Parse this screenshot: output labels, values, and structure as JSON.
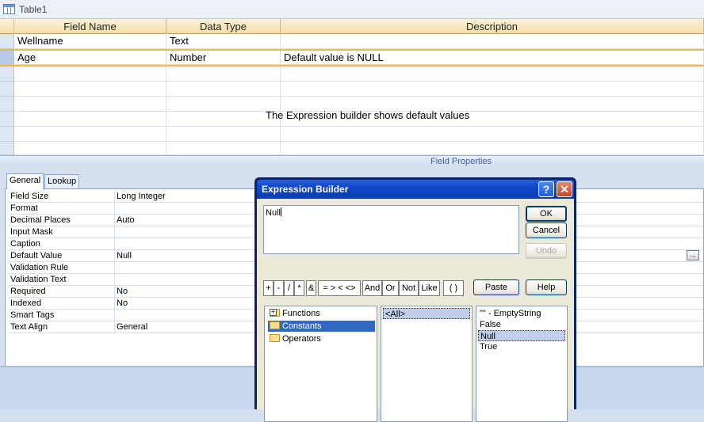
{
  "window": {
    "title": "Table1"
  },
  "grid": {
    "headers": [
      "Field Name",
      "Data Type",
      "Description"
    ],
    "rows": [
      {
        "field_name": "Wellname",
        "data_type": "Text",
        "description": ""
      },
      {
        "field_name": "Age",
        "data_type": "Number",
        "description": "Default value is NULL"
      }
    ],
    "annotation": "The Expression builder shows default values"
  },
  "field_properties": {
    "title": "Field Properties",
    "tabs": [
      "General",
      "Lookup"
    ],
    "rows": [
      {
        "label": "Field Size",
        "value": "Long Integer"
      },
      {
        "label": "Format",
        "value": ""
      },
      {
        "label": "Decimal Places",
        "value": "Auto"
      },
      {
        "label": "Input Mask",
        "value": ""
      },
      {
        "label": "Caption",
        "value": ""
      },
      {
        "label": "Default Value",
        "value": "Null"
      },
      {
        "label": "Validation Rule",
        "value": ""
      },
      {
        "label": "Validation Text",
        "value": ""
      },
      {
        "label": "Required",
        "value": "No"
      },
      {
        "label": "Indexed",
        "value": "No"
      },
      {
        "label": "Smart Tags",
        "value": ""
      },
      {
        "label": "Text Align",
        "value": "General"
      }
    ],
    "build_button": "..."
  },
  "dialog": {
    "title": "Expression Builder",
    "help_glyph": "?",
    "close_glyph": "✕",
    "expression": "Null",
    "buttons": {
      "ok": "OK",
      "cancel": "Cancel",
      "undo": "Undo",
      "paste": "Paste",
      "help": "Help"
    },
    "operators": [
      "+",
      "-",
      "/",
      "*",
      "&",
      "= > < <>",
      "And",
      "Or",
      "Not",
      "Like",
      "( )"
    ],
    "folders": [
      {
        "label": "Functions",
        "expandable": true
      },
      {
        "label": "Constants",
        "selected": true
      },
      {
        "label": "Operators"
      }
    ],
    "categories": [
      "<All>"
    ],
    "values": [
      "\"\" - EmptyString",
      "False",
      "Null",
      "True"
    ]
  }
}
